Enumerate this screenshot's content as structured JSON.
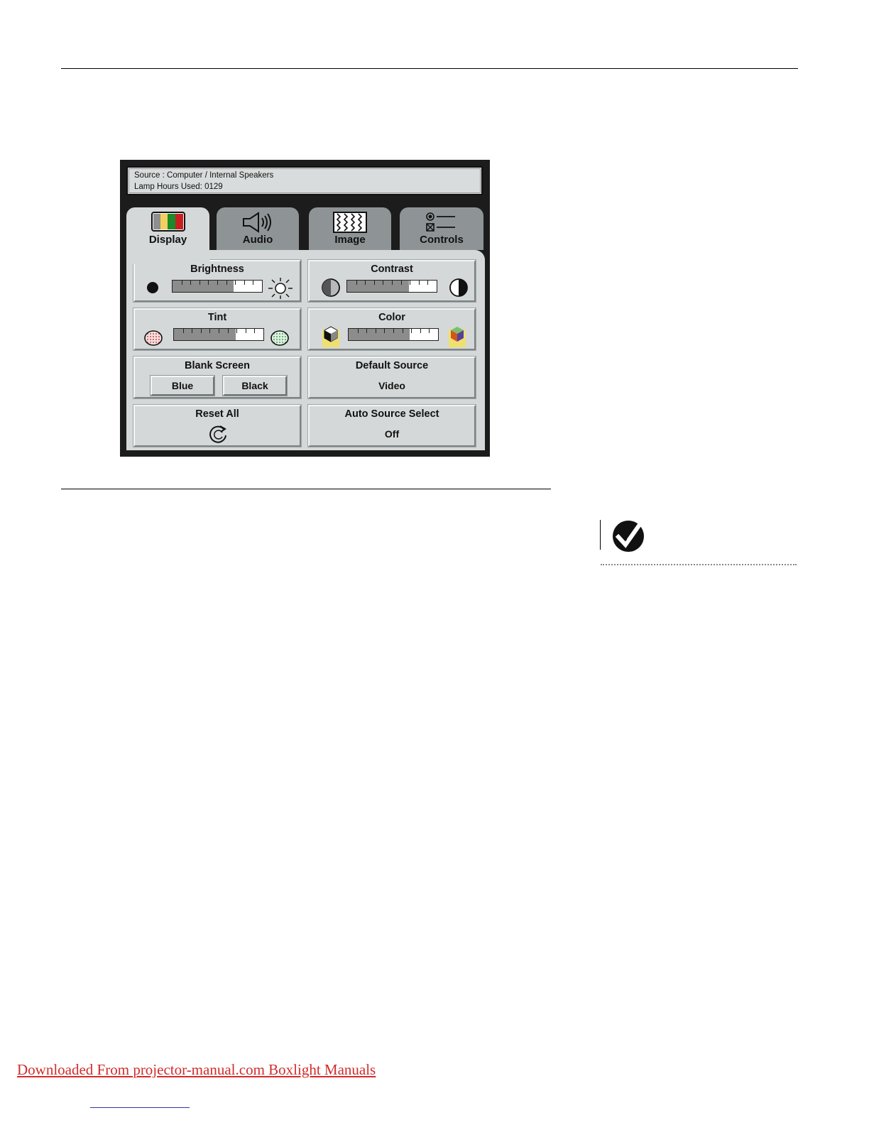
{
  "osd": {
    "info": {
      "source": "Source : Computer / Internal Speakers",
      "lamp_hours": "Lamp Hours Used: 0129"
    },
    "tabs": [
      {
        "label": "Display",
        "icon": "color-bars-icon",
        "active": true
      },
      {
        "label": "Audio",
        "icon": "speaker-icon",
        "active": false
      },
      {
        "label": "Image",
        "icon": "image-pattern-icon",
        "active": false
      },
      {
        "label": "Controls",
        "icon": "controls-list-icon",
        "active": false
      }
    ],
    "brightness": {
      "label": "Brightness",
      "level": 0.68,
      "min_icon": "dark-dot-icon",
      "max_icon": "sun-icon"
    },
    "contrast": {
      "label": "Contrast",
      "level": 0.69,
      "min_icon": "low-contrast-icon",
      "max_icon": "high-contrast-icon"
    },
    "tint": {
      "label": "Tint",
      "level": 0.69,
      "min_icon": "red-tint-icon",
      "max_icon": "green-tint-icon"
    },
    "color": {
      "label": "Color",
      "level": 0.68,
      "min_icon": "mono-cube-icon",
      "max_icon": "color-cube-icon"
    },
    "blank_screen": {
      "label": "Blank Screen",
      "options": [
        "Blue",
        "Black"
      ]
    },
    "default_source": {
      "label": "Default Source",
      "value": "Video"
    },
    "reset_all": {
      "label": "Reset All",
      "icon": "reset-icon"
    },
    "auto_source_select": {
      "label": "Auto Source Select",
      "value": "Off"
    }
  },
  "note_icon": "check-note-icon",
  "footer": {
    "link_text": "Downloaded From projector-manual.com Boxlight Manuals"
  },
  "colors": {
    "tab_active": "#d4d8d8",
    "tab_inactive": "#8e9496",
    "osd_frame": "#1c1c1c",
    "footer_link": "#d22b2b"
  }
}
